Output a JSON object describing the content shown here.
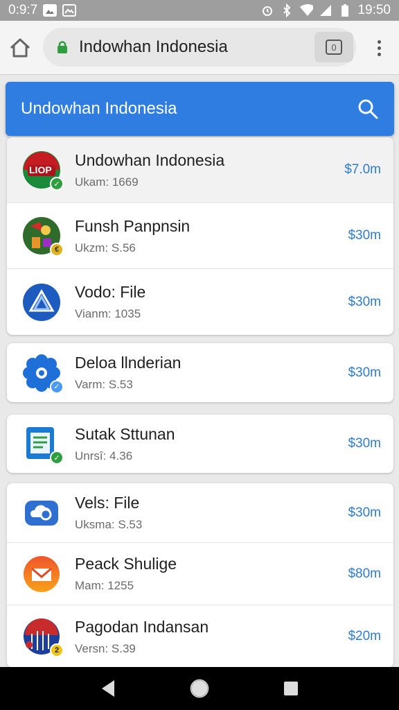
{
  "statusbar": {
    "left_time": "0:9:7",
    "right_time": "19:50"
  },
  "browser": {
    "url": "Indowhan Indonesia",
    "tab_count": "0"
  },
  "appbar": {
    "title": "Undowhan Indonesia"
  },
  "apps": [
    {
      "name": "Undowhan Indonesia",
      "sub": "Ukam: 1669",
      "price": "$7.0m",
      "icon_text": "LIOP",
      "icon": "flag-logo-icon",
      "badge": "verified-check-icon"
    },
    {
      "name": "Funsh Panpnsin",
      "sub": "Ukzm: S.56",
      "price": "$30m",
      "icon": "colorful-game-icon",
      "badge": "coin-badge-icon"
    },
    {
      "name": "Vodo: File",
      "sub": "Vianm: 1035",
      "price": "$30m",
      "icon": "blue-triangle-logo-icon"
    },
    {
      "name": "Deloa llnderian",
      "sub": "Varm: S.53",
      "price": "$30m",
      "icon": "blue-gear-icon",
      "badge": "verified-check-icon"
    },
    {
      "name": "Sutak Sttunan",
      "sub": "Unrsî: 4.36",
      "price": "$30m",
      "icon": "document-icon",
      "badge": "verified-check-icon"
    },
    {
      "name": "Vels: File",
      "sub": "Uksma: S.53",
      "price": "$30m",
      "icon": "cloud-sync-icon"
    },
    {
      "name": "Peack Shulige",
      "sub": "Mam: 1255",
      "price": "$80m",
      "icon": "orange-mail-icon"
    },
    {
      "name": "Pagodan Indansan",
      "sub": "Versn: S.39",
      "price": "$20m",
      "icon": "building-logo-icon",
      "badge": "number-badge-icon",
      "badge_text": "2"
    }
  ],
  "colors": {
    "accent": "#2f7de1",
    "price": "#2f7bd0",
    "verified": "#2e9e3f"
  }
}
